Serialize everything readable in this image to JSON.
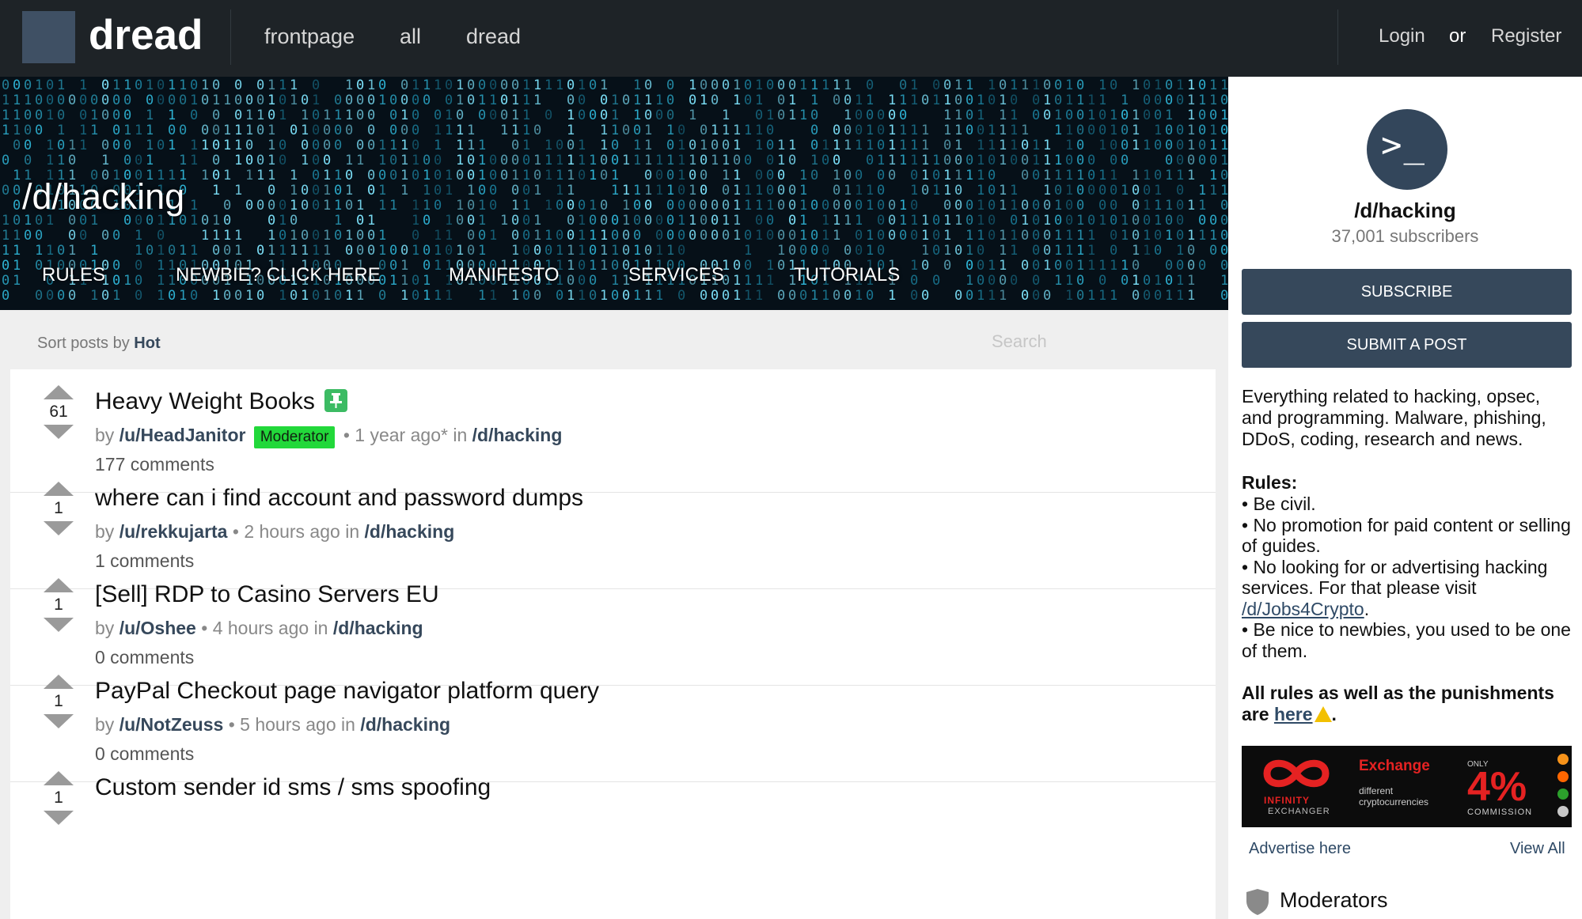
{
  "header": {
    "logo": "dread",
    "nav": [
      "frontpage",
      "all",
      "dread"
    ],
    "login": "Login",
    "or": "or",
    "register": "Register"
  },
  "banner": {
    "title": "/d/hacking",
    "links": [
      "RULES",
      "NEWBIE? CLICK HERE",
      "MANIFESTO",
      "SERVICES",
      "TUTORIALS"
    ]
  },
  "sort": {
    "label": "Sort posts by",
    "value": "Hot",
    "search_placeholder": "Search"
  },
  "posts": [
    {
      "score": "61",
      "title": "Heavy Weight Books",
      "pinned": true,
      "author": "/u/HeadJanitor",
      "badge": "Moderator",
      "time": "1 year ago*",
      "in": "in",
      "sub": "/d/hacking",
      "comments": "177 comments"
    },
    {
      "score": "1",
      "title": "where can i find account and password dumps",
      "author": "/u/rekkujarta",
      "time": "2 hours ago",
      "in": "in",
      "sub": "/d/hacking",
      "comments": "1 comments"
    },
    {
      "score": "1",
      "title": "[Sell] RDP to Casino Servers EU",
      "author": "/u/Oshee",
      "time": "4 hours ago",
      "in": "in",
      "sub": "/d/hacking",
      "comments": "0 comments"
    },
    {
      "score": "1",
      "title": "PayPal Checkout page navigator platform query",
      "author": "/u/NotZeuss",
      "time": "5 hours ago",
      "in": "in",
      "sub": "/d/hacking",
      "comments": "0 comments"
    },
    {
      "score": "1",
      "title": "Custom sender id sms / sms spoofing",
      "author": "",
      "time": "",
      "in": "",
      "sub": "",
      "comments": ""
    }
  ],
  "meta_words": {
    "by": "by",
    "dot": "•"
  },
  "sidebar": {
    "avatar_glyph": ">_",
    "name": "/d/hacking",
    "subscribers": "37,001 subscribers",
    "subscribe": "SUBSCRIBE",
    "submit": "SUBMIT A POST",
    "description": "Everything related to hacking, opsec, and programming. Malware, phishing, DDoS, coding, research and news.",
    "rules_heading": "Rules:",
    "rule1": "• Be civil.",
    "rule2": "• No promotion for paid content or selling of guides.",
    "rule3_pre": "• No looking for or advertising hacking services. For that please visit ",
    "rule3_link": "/d/Jobs4Crypto",
    "rule3_post": ".",
    "rule4": "• Be nice to newbies, you used to be one of them.",
    "all_rules_pre": "All rules as well as the punishments are ",
    "all_rules_link": "here",
    "all_rules_post": ".",
    "ad": {
      "brand": "INFINITY",
      "brand2": "EXCHANGER",
      "exchange": "Exchange",
      "different": "different cryptocurrencies",
      "only": "ONLY",
      "pct": "4%",
      "commission": "COMMISSION"
    },
    "advertise": "Advertise here",
    "view_all": "View All",
    "moderators": "Moderators"
  },
  "colors": {
    "topbar": "#1e2327",
    "accent": "#36485b",
    "moderator_badge": "#22d83a",
    "pin": "#3cbb63"
  }
}
